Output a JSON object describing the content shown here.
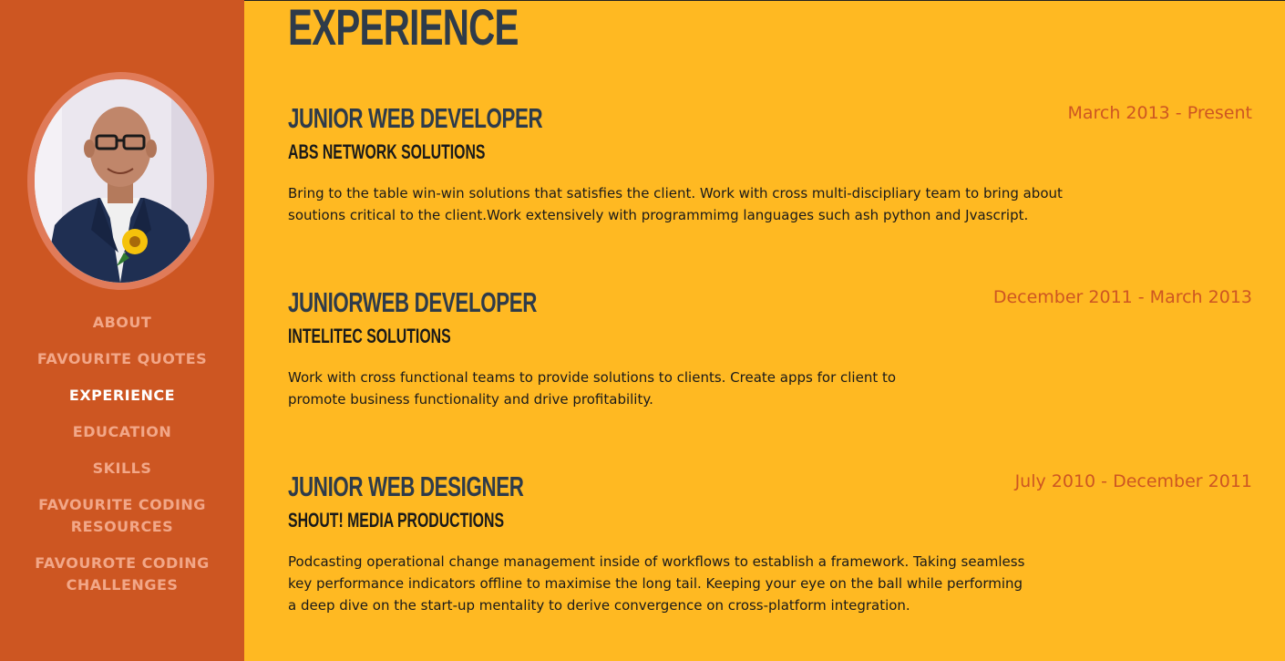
{
  "sidebar": {
    "nav": [
      {
        "label": "ABOUT"
      },
      {
        "label": "FAVOURITE QUOTES"
      },
      {
        "label": "EXPERIENCE",
        "active": true
      },
      {
        "label": "EDUCATION"
      },
      {
        "label": "SKILLS"
      },
      {
        "label": "FAVOURITE CODING RESOURCES"
      },
      {
        "label": "FAVOUROTE CODING CHALLENGES"
      }
    ]
  },
  "main": {
    "title": "EXPERIENCE",
    "jobs": [
      {
        "title": "JUNIOR WEB DEVELOPER",
        "company": "ABS NETWORK SOLUTIONS",
        "dates": "March 2013 - Present",
        "description": "Bring to the table win-win solutions that satisfies the client. Work with cross multi-discipliary team to bring about soutions critical to the client.Work extensively with programmimg languages such ash python and Jvascript."
      },
      {
        "title": "JUNIORWEB DEVELOPER",
        "company": "INTELITEC SOLUTIONS",
        "dates": "December 2011 - March 2013",
        "description": "Work with cross functional teams to provide solutions to clients. Create apps for client to promote business functionality and drive profitability."
      },
      {
        "title": "JUNIOR WEB DESIGNER",
        "company": "SHOUT! MEDIA PRODUCTIONS",
        "dates": "July 2010 - December 2011",
        "description": "Podcasting operational change management inside of workflows to establish a framework. Taking seamless key performance indicators offline to maximise the long tail. Keeping your eye on the ball while performing a deep dive on the start-up mentality to derive convergence on cross-platform integration."
      }
    ]
  },
  "colors": {
    "background": "#ffb922",
    "sidebar": "#cd5622",
    "heading": "#2e3b4a",
    "dates": "#cd5622",
    "nav_text": "#f2a788",
    "nav_active": "#ffffff"
  }
}
